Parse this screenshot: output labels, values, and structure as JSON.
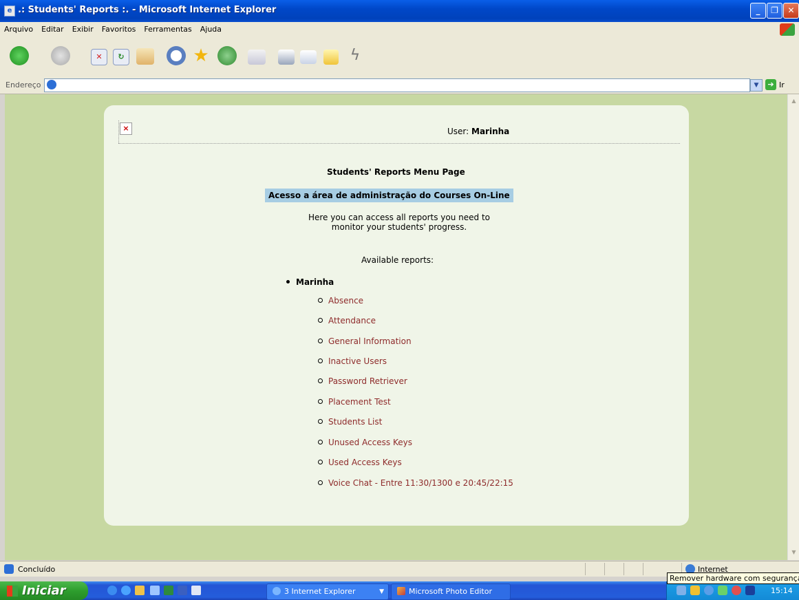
{
  "window": {
    "title": ".: Students' Reports :. - Microsoft Internet Explorer"
  },
  "menu": [
    "Arquivo",
    "Editar",
    "Exibir",
    "Favoritos",
    "Ferramentas",
    "Ajuda"
  ],
  "address": {
    "label": "Endereço",
    "value": "",
    "go_label": "Ir"
  },
  "header": {
    "user_prefix": "User:",
    "user_name": "Marinha"
  },
  "page": {
    "heading": "Students' Reports Menu Page",
    "admin_banner": "Acesso a área de administração do Courses On-Line",
    "intro_line1": "Here you can access all reports you need to",
    "intro_line2": "monitor your students' progress.",
    "available_label": "Available reports:",
    "group_name": "Marinha"
  },
  "reports": [
    "Absence",
    "Attendance",
    "General Information",
    "Inactive Users",
    "Password Retriever",
    "Placement Test",
    "Students List",
    "Unused Access Keys",
    "Used Access Keys",
    "Voice Chat - Entre 11:30/1300 e 20:45/22:15"
  ],
  "status": {
    "text": "Concluído",
    "zone": "Internet",
    "tooltip": "Remover hardware com segurança"
  },
  "taskbar": {
    "start_label": "Iniciar",
    "tasks": [
      "3 Internet Explorer",
      "Microsoft Photo Editor"
    ],
    "clock": "15:14"
  },
  "colors": {
    "page_background": "#c7d8a2",
    "card_background": "#f0f5e8",
    "banner_background": "#a7cde3",
    "link": "#8e2b2b"
  }
}
